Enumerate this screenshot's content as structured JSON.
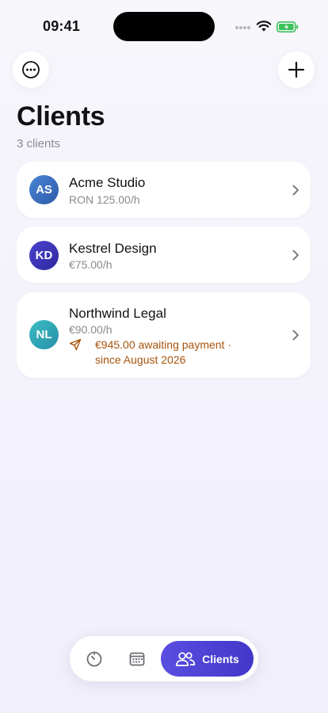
{
  "status_bar": {
    "time": "09:41"
  },
  "header": {
    "title": "Clients",
    "subtitle": "3 clients"
  },
  "clients": [
    {
      "initials": "AS",
      "name": "Acme Studio",
      "rate": "RON 125.00/h",
      "avatar_color": "#3a6fc2"
    },
    {
      "initials": "KD",
      "name": "Kestrel Design",
      "rate": "€75.00/h",
      "avatar_color": "#3a32b8"
    },
    {
      "initials": "NL",
      "name": "Northwind Legal",
      "rate": "€90.00/h",
      "avatar_color": "#2fa9b4",
      "awaiting_line1": "€945.00 awaiting payment ·",
      "awaiting_line2": "since August 2026"
    }
  ],
  "tabbar": {
    "tabs": [
      {
        "icon": "timer-icon"
      },
      {
        "icon": "calendar-icon"
      },
      {
        "icon": "clients-icon",
        "label": "Clients",
        "active": true
      }
    ]
  },
  "colors": {
    "accent": "#4a3fd6",
    "warning_text": "#a8540c",
    "background": "#f5f3fb"
  }
}
